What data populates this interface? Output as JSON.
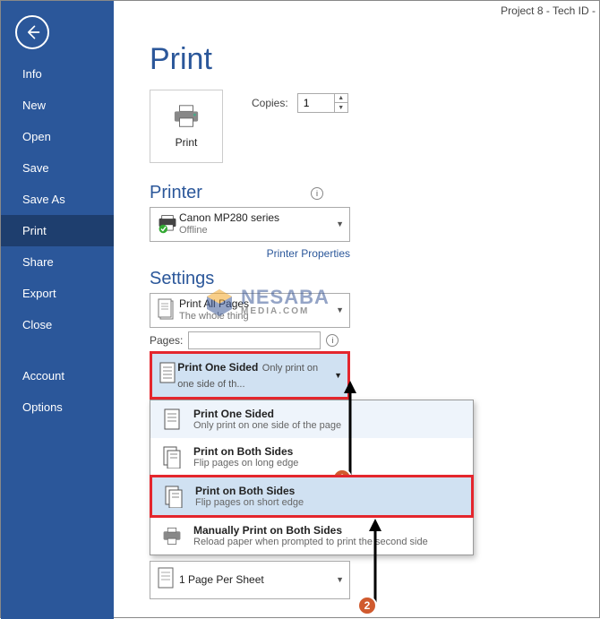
{
  "window_title": "Project 8 - Tech ID -",
  "sidebar": {
    "items": [
      "Info",
      "New",
      "Open",
      "Save",
      "Save As",
      "Print",
      "Share",
      "Export",
      "Close",
      "Account",
      "Options"
    ],
    "selected_index": 5
  },
  "page": {
    "title": "Print",
    "print_button_label": "Print",
    "copies_label": "Copies:",
    "copies_value": "1"
  },
  "printer": {
    "heading": "Printer",
    "name": "Canon MP280 series",
    "status": "Offline",
    "properties_link": "Printer Properties"
  },
  "settings": {
    "heading": "Settings",
    "print_what": {
      "title": "Print All Pages",
      "subtitle": "The whole thing"
    },
    "pages_label": "Pages:",
    "pages_value": "",
    "selected_side": {
      "title": "Print One Sided",
      "subtitle": "Only print on one side of th..."
    },
    "popup_options": [
      {
        "title": "Print One Sided",
        "subtitle": "Only print on one side of the page"
      },
      {
        "title": "Print on Both Sides",
        "subtitle": "Flip pages on long edge"
      },
      {
        "title": "Print on Both Sides",
        "subtitle": "Flip pages on short edge"
      },
      {
        "title": "Manually Print on Both Sides",
        "subtitle": "Reload paper when prompted to print the second side"
      }
    ],
    "per_sheet": "1 Page Per Sheet"
  },
  "annotations": {
    "step1": "1",
    "step2": "2"
  },
  "watermark": {
    "line1": "NESABA",
    "line2": "MEDIA.COM"
  }
}
